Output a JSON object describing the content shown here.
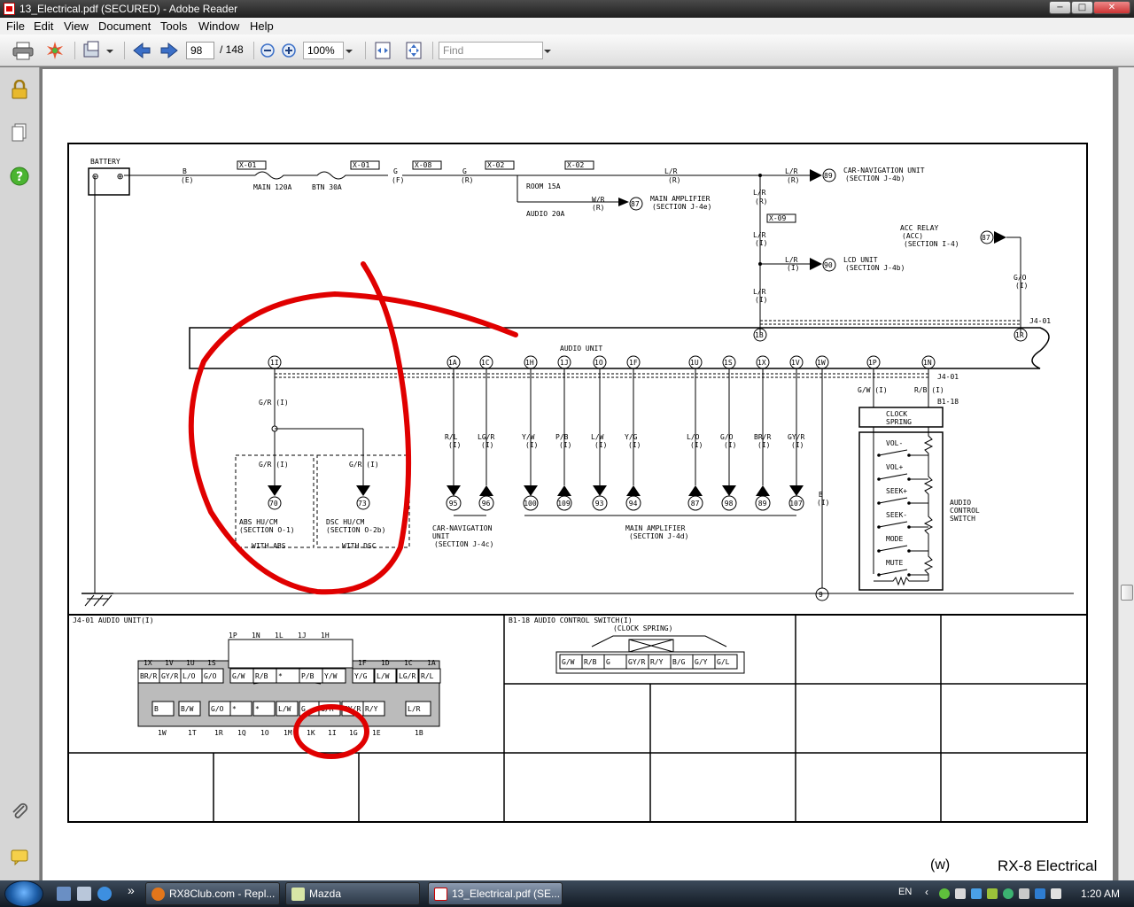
{
  "window": {
    "title": "13_Electrical.pdf (SECURED) - Adobe Reader",
    "controls": {
      "minimize": "−",
      "restore": "□",
      "close": "✕"
    }
  },
  "menu": {
    "file": "File",
    "edit": "Edit",
    "view": "View",
    "document": "Document",
    "tools": "Tools",
    "window": "Window",
    "help": "Help"
  },
  "toolbar": {
    "page_current": "98",
    "page_total": "/ 148",
    "zoom": "100%",
    "find_placeholder": "Find"
  },
  "nav_icons": [
    "lock-icon",
    "pages-icon",
    "help-icon",
    "attachment-icon",
    "comments-icon"
  ],
  "diagram": {
    "battery": "BATTERY",
    "fuses": {
      "x01a": "X-01",
      "x01b": "X-01",
      "x08": "X-08",
      "x02a": "X-02",
      "x02b": "X-02",
      "x09": "X-09",
      "main": "MAIN 120A",
      "btn": "BTN 30A",
      "room": "ROOM 15A",
      "audio": "AUDIO 20A"
    },
    "wires": {
      "b1": "B",
      "b1t": "(E)",
      "g1": "G",
      "g1t": "(F)",
      "g2": "G",
      "g2t": "(R)",
      "lr1": "L/R",
      "lr1t": "(R)",
      "lr2": "L/R",
      "lr2t": "(R)",
      "lr3": "L/R",
      "lr3t": "(R)",
      "lr4": "L/R",
      "lr4t": "(I)",
      "lr5": "L/R",
      "lr5t": "(I)",
      "lr6": "L/R",
      "lr6t": "(I)",
      "wr": "W/R",
      "wrt": "(R)",
      "go": "G/O",
      "got": "(I)",
      "gw": "G/W (I)",
      "rb": "R/B (I)",
      "gr_main": "G/R (I)",
      "gr_abs": "G/R (I)",
      "gr_dsc": "G/R (I)",
      "b2": "B",
      "b2t": "(I)"
    },
    "destinations": {
      "carnav_top_num": "89",
      "carnav_top": "CAR-NAVIGATION UNIT",
      "carnav_top_sec": "(SECTION J-4b)",
      "mainamp_top_num": "87",
      "mainamp_top": "MAIN AMPLIFIER",
      "mainamp_top_sec": "(SECTION J-4e)",
      "acc_num": "87",
      "acc_1": "ACC RELAY",
      "acc_2": "(ACC)",
      "acc_3": "(SECTION I-4)",
      "lcd_num": "90",
      "lcd": "LCD UNIT",
      "lcd_sec": "(SECTION J-4b)",
      "abs_num": "70",
      "abs_1": "ABS HU/CM",
      "abs_2": "(SECTION O-1)",
      "abs_3": "WITH ABS",
      "dsc_num": "73",
      "dsc_1": "DSC HU/CM",
      "dsc_2": "(SECTION O-2b)",
      "dsc_3": "WITH DSC",
      "carnav_1": "CAR-NAVIGATION",
      "carnav_2": "UNIT",
      "carnav_3": "(SECTION J-4c)",
      "mainamp_1": "MAIN AMPLIFIER",
      "mainamp_2": "(SECTION J-4d)"
    },
    "audio_unit": "AUDIO UNIT",
    "connector_j401": "J4-01",
    "connector_j401b": "J4-01",
    "connector_b118": "B1-18",
    "clock_spring_1": "CLOCK",
    "clock_spring_2": "SPRING",
    "acs_1": "AUDIO",
    "acs_2": "CONTROL",
    "acs_3": "SWITCH",
    "switches": [
      "VOL-",
      "VOL+",
      "SEEK+",
      "SEEK-",
      "MODE",
      "MUTE"
    ],
    "pins": {
      "1I": "1I",
      "1A": "1A",
      "1C": "1C",
      "1H": "1H",
      "1J": "1J",
      "1O": "1O",
      "1F": "1F",
      "1U": "1U",
      "1S": "1S",
      "1X": "1X",
      "1V": "1V",
      "1W": "1W",
      "1P": "1P",
      "1N": "1N",
      "1B": "1B",
      "1R": "1R",
      "9": "9"
    },
    "pin_wires": [
      {
        "c": "R/L",
        "t": "(I)",
        "n": "95"
      },
      {
        "c": "LG/R",
        "t": "(I)",
        "n": "96"
      },
      {
        "c": "Y/W",
        "t": "(I)",
        "n": "100"
      },
      {
        "c": "P/B",
        "t": "(I)",
        "n": "109"
      },
      {
        "c": "L/W",
        "t": "(I)",
        "n": "93"
      },
      {
        "c": "Y/G",
        "t": "(I)",
        "n": "94"
      },
      {
        "c": "L/O",
        "t": "(I)",
        "n": "87"
      },
      {
        "c": "G/O",
        "t": "(I)",
        "n": "98"
      },
      {
        "c": "BR/R",
        "t": "(I)",
        "n": "89"
      },
      {
        "c": "GY/R",
        "t": "(I)",
        "n": "107"
      }
    ],
    "conn_table": {
      "title_j4": "J4-01 AUDIO UNIT(I)",
      "top_pins": [
        "1P",
        "1N",
        "1L",
        "1J",
        "1H"
      ],
      "row_top_labels": [
        "1X",
        "1V",
        "1U",
        "1S",
        "1F",
        "1D",
        "1C",
        "1A"
      ],
      "row1_left": [
        "BR/R",
        "GY/R",
        "L/O",
        "G/O"
      ],
      "row1_mid": [
        "G/W",
        "R/B",
        "*",
        "P/B",
        "Y/W"
      ],
      "row1_right": [
        "Y/G",
        "L/W",
        "LG/R",
        "R/L"
      ],
      "row2": [
        "B",
        "B/W",
        "G/O",
        "*",
        "*",
        "L/W",
        "G",
        "G/R",
        "GY/R",
        "R/Y",
        "L/R"
      ],
      "row_bottom_labels": [
        "1W",
        "1T",
        "1R",
        "1Q",
        "1O",
        "1M",
        "1K",
        "1I",
        "1G",
        "1E",
        "1B"
      ],
      "title_b1": "B1-18 AUDIO CONTROL SWITCH(I)",
      "b1_sub": "(CLOCK SPRING)",
      "b1_pins": [
        "G/W",
        "R/B",
        "G",
        "GY/R",
        "R/Y",
        "B/G",
        "G/Y",
        "G/L"
      ]
    }
  },
  "footer": {
    "page_label": "(w)",
    "book": "RX-8 Electrical"
  },
  "taskbar": {
    "tasks": [
      {
        "label": "RX8Club.com - Repl...",
        "icon": "firefox-icon"
      },
      {
        "label": "Mazda",
        "icon": "notepad-icon"
      },
      {
        "label": "13_Electrical.pdf (SE...",
        "icon": "pdf-icon"
      }
    ],
    "lang": "EN",
    "time": "1:20 AM"
  }
}
